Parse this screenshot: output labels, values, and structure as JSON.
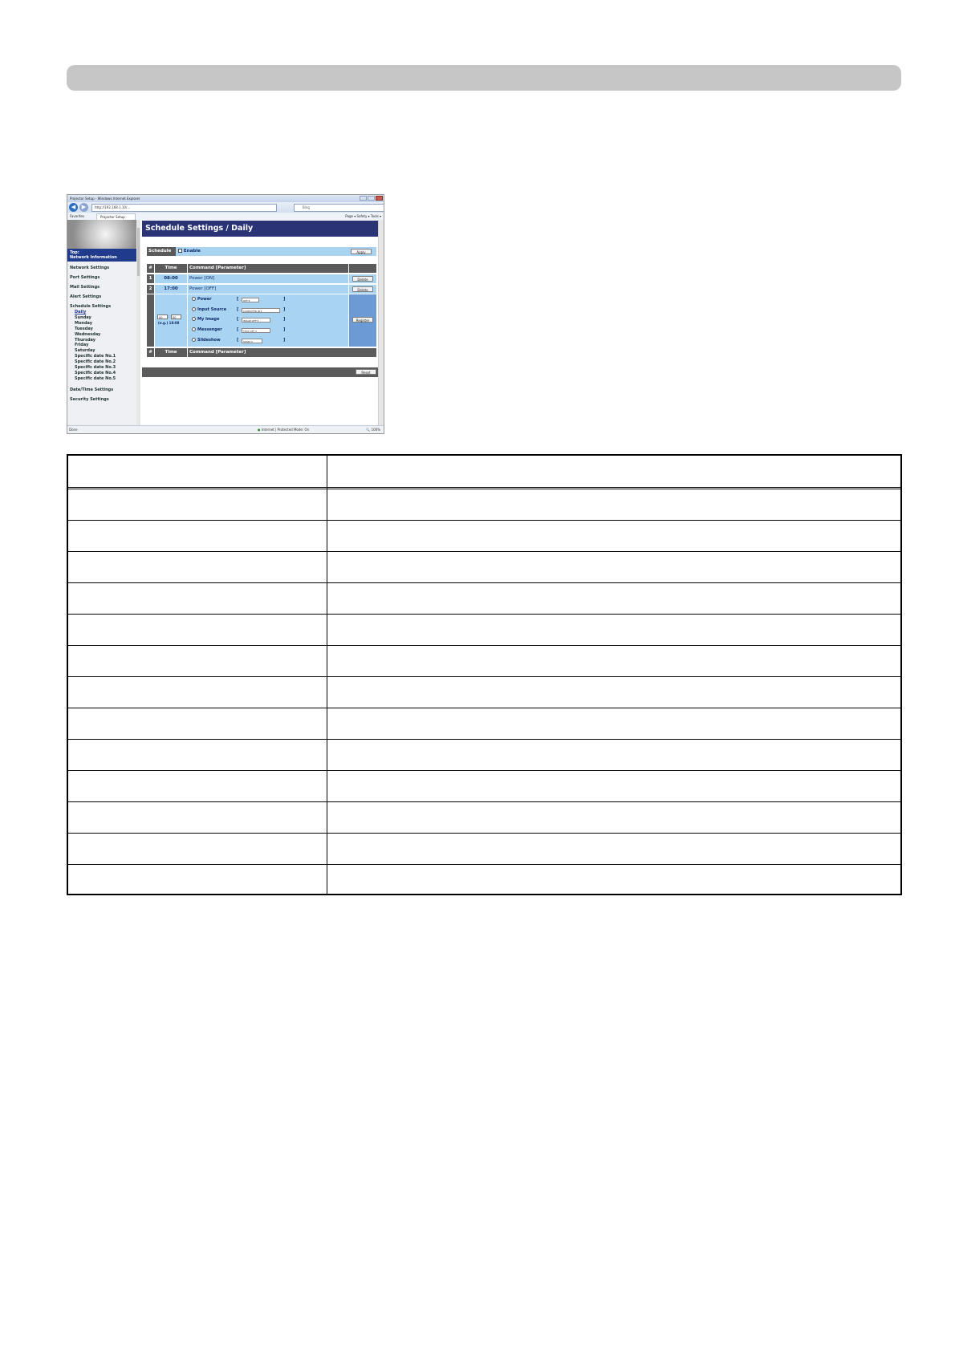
{
  "browser": {
    "window_title": "Projector Setup - Windows Internet Explorer",
    "address": "http://192.168.1.10/...",
    "search_placeholder": "Bing",
    "favorites_label": "Favorites",
    "tab_label": "Projector Setup",
    "toolbar_items": "Page ▾  Safety ▾  Tools ▾",
    "status_left": "Done",
    "status_zone": "Internet | Protected Mode: On",
    "status_zoom": "100%"
  },
  "sidebar": {
    "top_label": "Top:",
    "top_sub": "Network Information",
    "items": [
      "Network Settings",
      "Port Settings",
      "Mail Settings",
      "Alert Settings"
    ],
    "schedule_heading": "Schedule Settings",
    "schedule_items": [
      "Daily",
      "Sunday",
      "Monday",
      "Tuesday",
      "Wednesday",
      "Thursday",
      "Friday",
      "Saturday",
      "Specific date No.1",
      "Specific date No.2",
      "Specific date No.3",
      "Specific date No.4",
      "Specific date No.5"
    ],
    "bottom_items": [
      "Date/Time Settings",
      "Security Settings"
    ]
  },
  "schedule": {
    "title": "Schedule Settings / Daily",
    "schedule_label": "Schedule",
    "enable_label": "Enable",
    "apply_label": "Apply",
    "col_num": "#",
    "col_time": "Time",
    "col_command": "Command [Parameter]",
    "entries": [
      {
        "num": "1",
        "time": "08:00",
        "command": "Power [ON]",
        "action": "Delete"
      },
      {
        "num": "2",
        "time": "17:00",
        "command": "Power [OFF]",
        "action": "Delete"
      }
    ],
    "new_entry": {
      "hour": "00",
      "minute": "00",
      "example": "(e.g.) 18:08",
      "commands": [
        {
          "label": "Power",
          "value": "OFF"
        },
        {
          "label": "Input Source",
          "value": "COMPUTER IN"
        },
        {
          "label": "My Image",
          "value": "IMAGE-OFF"
        },
        {
          "label": "Messenger",
          "value": "TEXT-OFF"
        },
        {
          "label": "Slideshow",
          "value": "START"
        }
      ],
      "register_label": "Register"
    },
    "reset_label": "Reset"
  },
  "table": {
    "header": [
      "",
      ""
    ],
    "rows": [
      [
        "",
        ""
      ],
      [
        "",
        ""
      ],
      [
        "",
        ""
      ],
      [
        "",
        ""
      ],
      [
        "",
        ""
      ],
      [
        "",
        ""
      ],
      [
        "",
        ""
      ],
      [
        "",
        ""
      ],
      [
        "",
        ""
      ],
      [
        "",
        ""
      ],
      [
        "",
        ""
      ],
      [
        "",
        ""
      ],
      [
        "",
        ""
      ]
    ]
  }
}
